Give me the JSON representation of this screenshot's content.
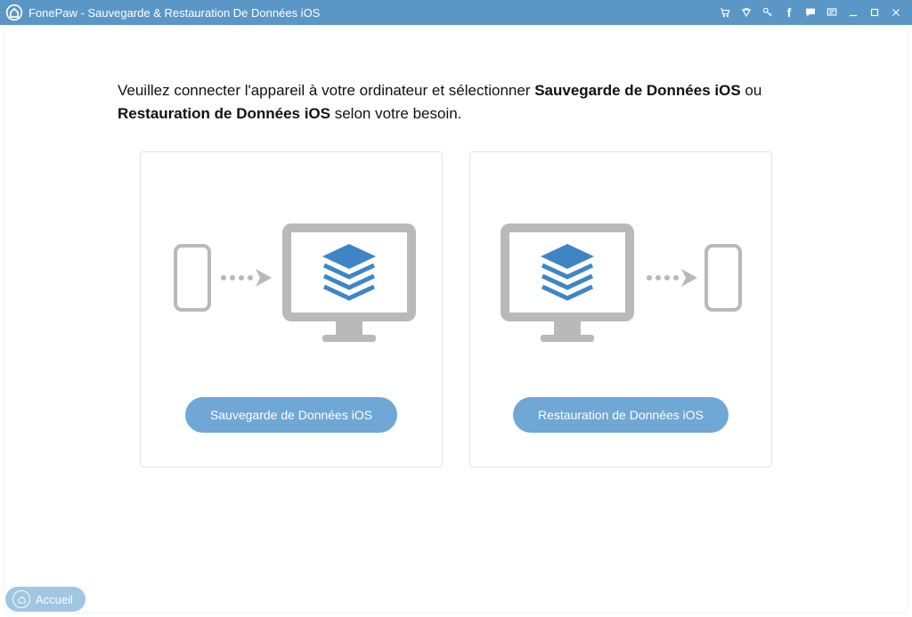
{
  "titlebar": {
    "app_title": "FonePaw - Sauvegarde & Restauration De Données iOS"
  },
  "instruction": {
    "prefix": "Veuillez connecter l'appareil à votre ordinateur et sélectionner ",
    "bold1": "Sauvegarde de Données iOS",
    "mid": " ou ",
    "bold2": "Restauration de Données iOS",
    "suffix": " selon votre besoin."
  },
  "cards": {
    "backup_button": "Sauvegarde de Données iOS",
    "restore_button": "Restauration de Données iOS"
  },
  "home": {
    "label": "Accueil"
  }
}
